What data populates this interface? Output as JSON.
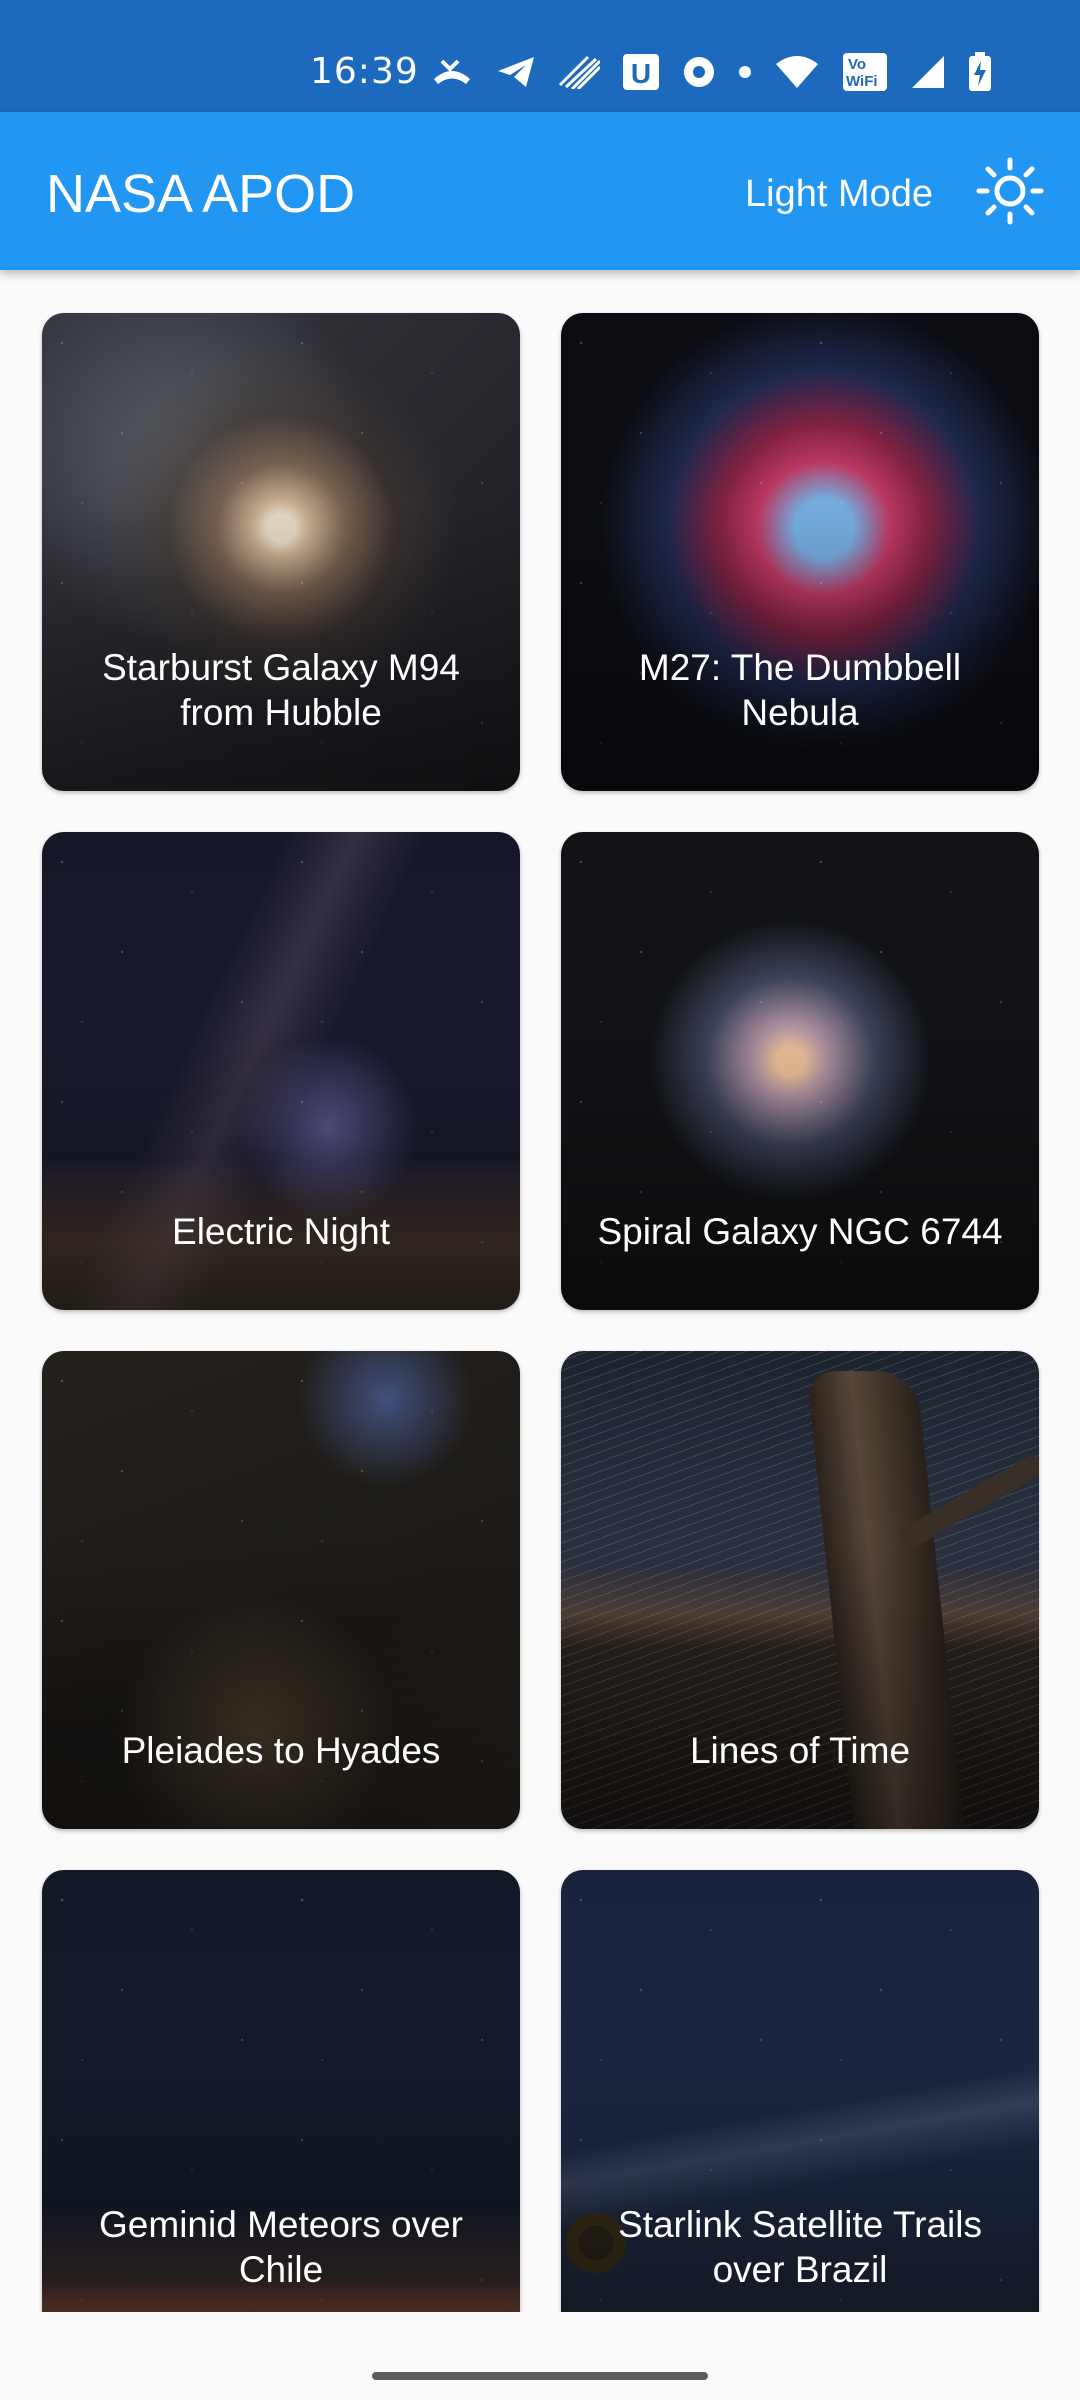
{
  "status_bar": {
    "time": "16:39",
    "icons": [
      "missed-call-icon",
      "telegram-icon",
      "signal-stripes-icon",
      "u-app-icon",
      "zee5-icon",
      "dot-icon",
      "wifi-icon",
      "vowifi-icon",
      "cell-signal-icon",
      "battery-charging-icon"
    ],
    "vowifi_text": [
      "Vo",
      "WiFi"
    ],
    "u_letter": "U"
  },
  "app_bar": {
    "title": "NASA APOD",
    "mode_label": "Light Mode",
    "mode_icon": "sun-icon",
    "color": "#2196f3"
  },
  "status_color": "#1c69bd",
  "cards": [
    {
      "title": "Starburst Galaxy M94 from Hubble"
    },
    {
      "title": "M27: The Dumbbell Nebula"
    },
    {
      "title": "Electric Night"
    },
    {
      "title": "Spiral Galaxy NGC 6744"
    },
    {
      "title": "Pleiades to Hyades"
    },
    {
      "title": "Lines of Time"
    },
    {
      "title": "Geminid Meteors over Chile"
    },
    {
      "title": "Starlink Satellite Trails over Brazil"
    }
  ]
}
